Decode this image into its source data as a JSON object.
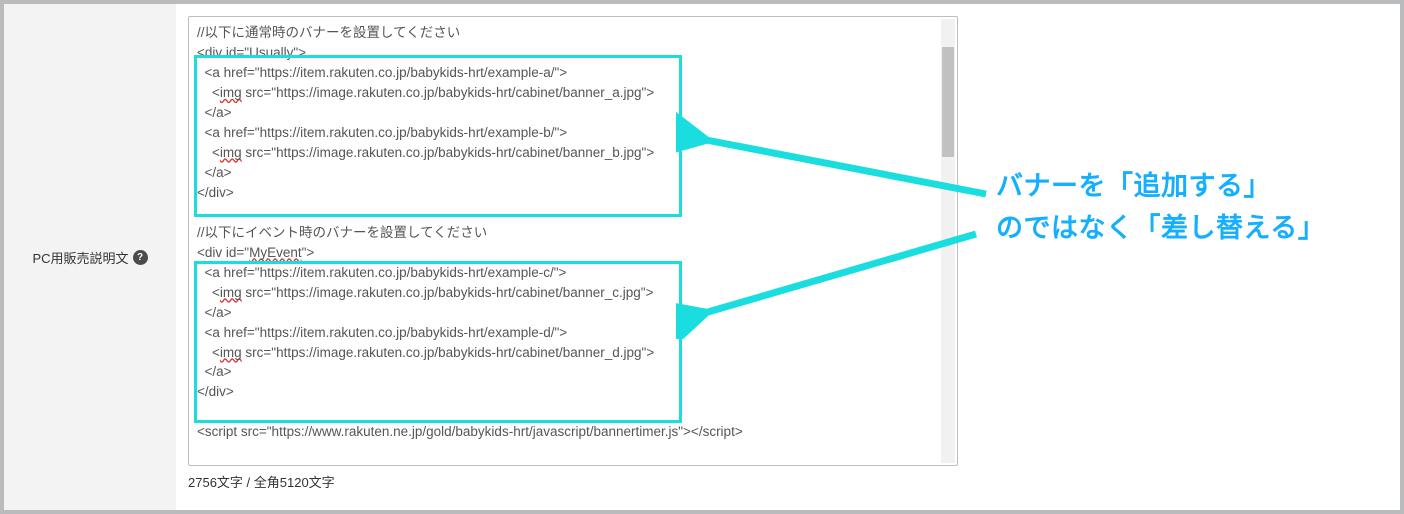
{
  "label": {
    "text": "PC用販売説明文",
    "help_icon": "?"
  },
  "code": {
    "comment1": "//以下に通常時のバナーを設置してください",
    "usually": {
      "open": "<div id=\"Usually\">",
      "a1_open": "  <a href=\"https://item.rakuten.co.jp/babykids-hrt/example-a/\">",
      "img1": "    <img src=\"https://image.rakuten.co.jp/babykids-hrt/cabinet/banner_a.jpg\">",
      "a1_close": "  </a>",
      "a2_open": "  <a href=\"https://item.rakuten.co.jp/babykids-hrt/example-b/\">",
      "img2": "    <img src=\"https://image.rakuten.co.jp/babykids-hrt/cabinet/banner_b.jpg\">",
      "a2_close": "  </a>",
      "close": "</div>"
    },
    "comment2": "//以下にイベント時のバナーを設置してください",
    "myevent": {
      "open_pre": "<div id=\"",
      "open_id": "MyEvent",
      "open_post": "\">",
      "a1_open": "  <a href=\"https://item.rakuten.co.jp/babykids-hrt/example-c/\">",
      "img1": "    <img src=\"https://image.rakuten.co.jp/babykids-hrt/cabinet/banner_c.jpg\">",
      "a1_close": "  </a>",
      "a2_open": "  <a href=\"https://item.rakuten.co.jp/babykids-hrt/example-d/\">",
      "img2": "    <img src=\"https://image.rakuten.co.jp/babykids-hrt/cabinet/banner_d.jpg\">",
      "a2_close": "  </a>",
      "close": "</div>"
    },
    "script_line": "<script src=\"https://www.rakuten.ne.jp/gold/babykids-hrt/javascript/bannertimer.js\"></script>",
    "img_tag": "img"
  },
  "counter": "2756文字 / 全角5120文字",
  "annotation": {
    "line1": "バナーを「追加する」",
    "line2": "のではなく「差し替える」"
  }
}
